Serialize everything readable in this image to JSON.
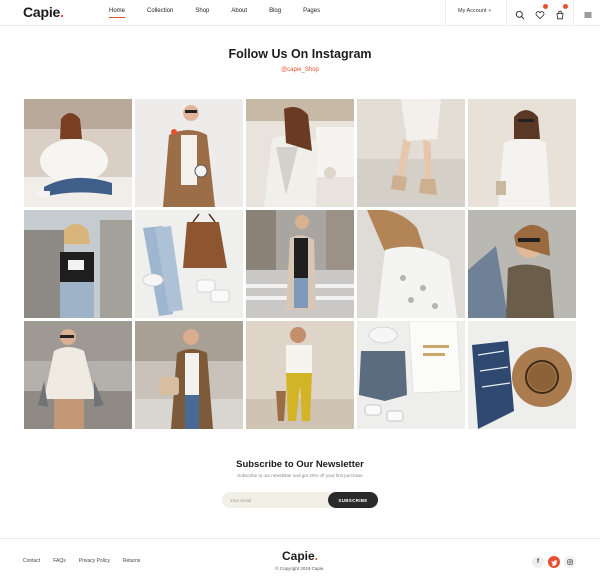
{
  "header": {
    "logo": "Capie",
    "logo_dot": ".",
    "nav": [
      "Home",
      "Collection",
      "Shop",
      "About",
      "Blog",
      "Pages"
    ],
    "account_label": "My Account",
    "icons": [
      "search-icon",
      "heart-icon",
      "cart-icon",
      "menu-icon"
    ]
  },
  "instagram": {
    "title": "Follow Us On Instagram",
    "handle": "@capie_Shop"
  },
  "newsletter": {
    "title": "Subscribe to Our Newsletter",
    "subtitle": "Subscribe to our newsletter and get 20% off your first purchase",
    "placeholder": "Your email",
    "button": "SUBSCRIBE"
  },
  "footer": {
    "links": [
      "Contact",
      "FAQs",
      "Privacy Policy",
      "Returns"
    ],
    "logo": "Capie",
    "logo_dot": ".",
    "copyright": "© Copyright 2019 Capie.",
    "social": [
      "facebook-icon",
      "twitter-icon",
      "instagram-icon"
    ]
  },
  "colors": {
    "accent": "#e8502f",
    "dark": "#2a2a2a",
    "input_bg": "#f1efe6"
  }
}
